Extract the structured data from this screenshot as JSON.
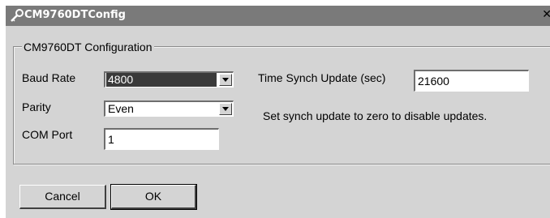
{
  "window": {
    "title": "CM9760DTConfig",
    "close_glyph": "✕",
    "icon": "key-wrench-icon"
  },
  "group": {
    "legend": "CM9760DT Configuration"
  },
  "fields": {
    "baud_rate": {
      "label": "Baud Rate",
      "value": "4800"
    },
    "parity": {
      "label": "Parity",
      "value": "Even"
    },
    "com_port": {
      "label": "COM Port",
      "value": "1"
    },
    "time_synch": {
      "label": "Time Synch Update (sec)",
      "value": "21600"
    }
  },
  "hint": "Set synch update to zero to disable updates.",
  "buttons": {
    "cancel": "Cancel",
    "ok": "OK"
  }
}
